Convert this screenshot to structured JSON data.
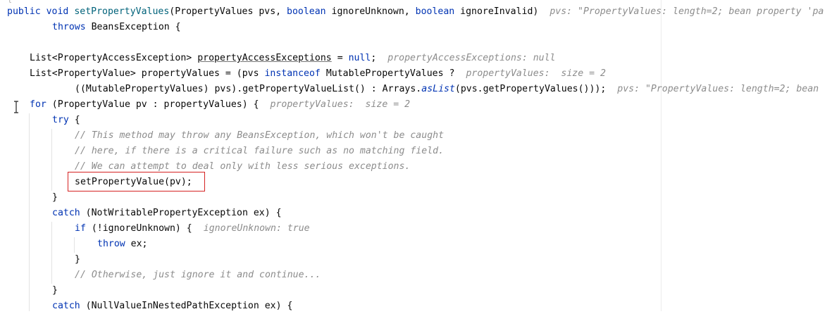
{
  "code_lines": [
    {
      "tokens": [
        [
          "kw",
          "public"
        ],
        [
          "id",
          " "
        ],
        [
          "kw",
          "void"
        ],
        [
          "id",
          " "
        ],
        [
          "mc",
          "setPropertyValues"
        ],
        [
          "id",
          "(PropertyValues pvs, "
        ],
        [
          "kw",
          "boolean"
        ],
        [
          "id",
          " ignoreUnknown, "
        ],
        [
          "kw",
          "boolean"
        ],
        [
          "id",
          " ignoreInvalid)"
        ]
      ],
      "hint": "pvs: \"PropertyValues: length=2; bean property 'pa"
    },
    {
      "tokens": [
        [
          "kw",
          "throws"
        ],
        [
          "id",
          " BeansException {"
        ]
      ],
      "hint": ""
    },
    {
      "tokens": [],
      "hint": ""
    },
    {
      "tokens": [
        [
          "id",
          "List<PropertyAccessException> "
        ],
        [
          "fld",
          "propertyAccessExceptions"
        ],
        [
          "id",
          " = "
        ],
        [
          "kw",
          "null"
        ],
        [
          "id",
          ";"
        ]
      ],
      "hint": "propertyAccessExceptions: null"
    },
    {
      "tokens": [
        [
          "id",
          "List<PropertyValue> propertyValues = (pvs "
        ],
        [
          "kw",
          "instanceof"
        ],
        [
          "id",
          " MutablePropertyValues ?"
        ]
      ],
      "hint": "propertyValues:  size = 2"
    },
    {
      "tokens": [
        [
          "id",
          "((MutablePropertyValues) pvs).getPropertyValueList() : Arrays."
        ],
        [
          "st",
          "asList"
        ],
        [
          "id",
          "(pvs.getPropertyValues()));"
        ]
      ],
      "hint": "pvs: \"PropertyValues: length=2; bean"
    },
    {
      "tokens": [
        [
          "kw",
          "for"
        ],
        [
          "id",
          " (PropertyValue pv : propertyValues) {"
        ]
      ],
      "hint": "propertyValues:  size = 2"
    },
    {
      "tokens": [
        [
          "kw",
          "try"
        ],
        [
          "id",
          " {"
        ]
      ],
      "hint": ""
    },
    {
      "tokens": [
        [
          "cm",
          "// This method may throw any BeansException, which won't be caught"
        ]
      ],
      "hint": ""
    },
    {
      "tokens": [
        [
          "cm",
          "// here, if there is a critical failure such as no matching field."
        ]
      ],
      "hint": ""
    },
    {
      "tokens": [
        [
          "cm",
          "// We can attempt to deal only with less serious exceptions."
        ]
      ],
      "hint": ""
    },
    {
      "tokens": [
        [
          "id",
          "setPropertyValue(pv);"
        ]
      ],
      "hint": ""
    },
    {
      "tokens": [
        [
          "id",
          "}"
        ]
      ],
      "hint": ""
    },
    {
      "tokens": [
        [
          "kw",
          "catch"
        ],
        [
          "id",
          " (NotWritablePropertyException ex) {"
        ]
      ],
      "hint": ""
    },
    {
      "tokens": [
        [
          "kw",
          "if"
        ],
        [
          "id",
          " (!ignoreUnknown) {"
        ]
      ],
      "hint": "ignoreUnknown: true"
    },
    {
      "tokens": [
        [
          "kw",
          "throw"
        ],
        [
          "id",
          " ex;"
        ]
      ],
      "hint": ""
    },
    {
      "tokens": [
        [
          "id",
          "}"
        ]
      ],
      "hint": ""
    },
    {
      "tokens": [
        [
          "cm",
          "// Otherwise, just ignore it and continue..."
        ]
      ],
      "hint": ""
    },
    {
      "tokens": [
        [
          "id",
          "}"
        ]
      ],
      "hint": ""
    },
    {
      "tokens": [
        [
          "kw",
          "catch"
        ],
        [
          "id",
          " (NullValueInNestedPathException ex) {"
        ]
      ],
      "hint": ""
    }
  ],
  "top_glyph": "{",
  "cursor_icon": "text-cursor-icon"
}
